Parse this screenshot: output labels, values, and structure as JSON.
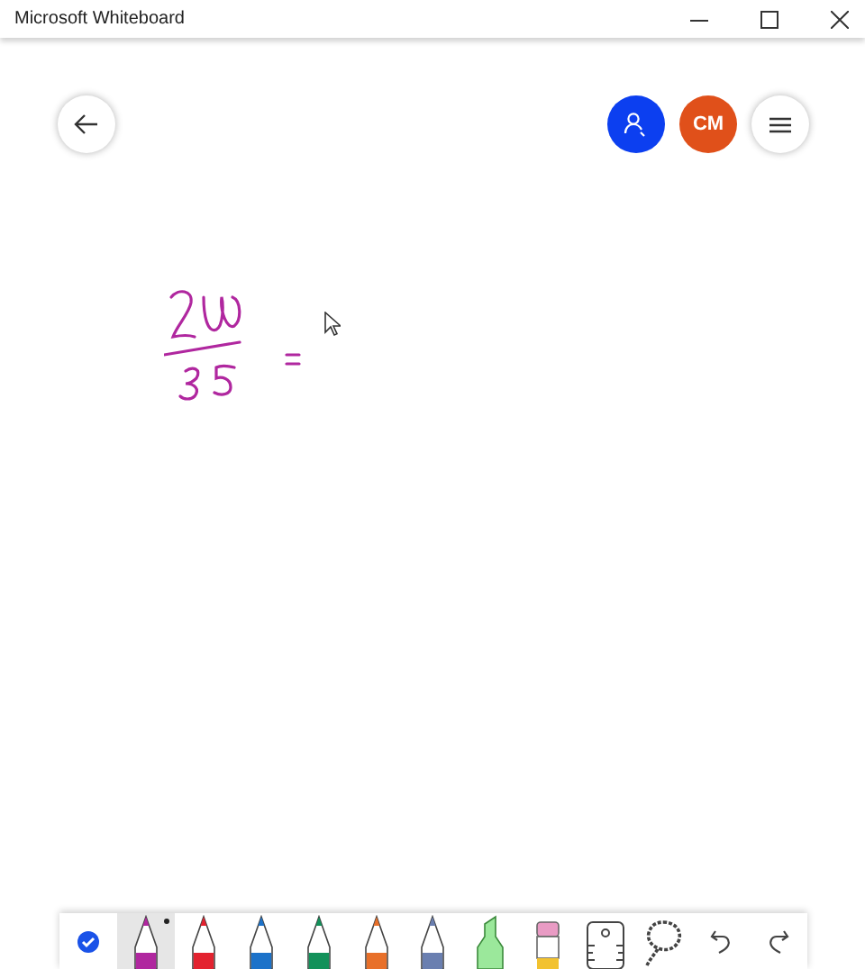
{
  "window": {
    "title": "Microsoft Whiteboard"
  },
  "avatar": {
    "initials": "CM"
  },
  "toolbar": [
    {
      "kind": "check",
      "selected": false
    },
    {
      "kind": "pen",
      "color": "#b0279f",
      "selected": true
    },
    {
      "kind": "pen",
      "color": "#e3222f",
      "selected": false
    },
    {
      "kind": "pen",
      "color": "#1c72c9",
      "selected": false
    },
    {
      "kind": "pen",
      "color": "#12915a",
      "selected": false
    },
    {
      "kind": "pen",
      "color": "#e8702a",
      "selected": false
    },
    {
      "kind": "pen",
      "color": "#6a7fb0",
      "selected": false
    },
    {
      "kind": "highlighter",
      "color": "#9be89b",
      "selected": false
    },
    {
      "kind": "eraser",
      "selected": false
    },
    {
      "kind": "ruler",
      "selected": false
    },
    {
      "kind": "lasso",
      "selected": false
    },
    {
      "kind": "undo",
      "selected": false
    },
    {
      "kind": "redo",
      "selected": false
    }
  ]
}
